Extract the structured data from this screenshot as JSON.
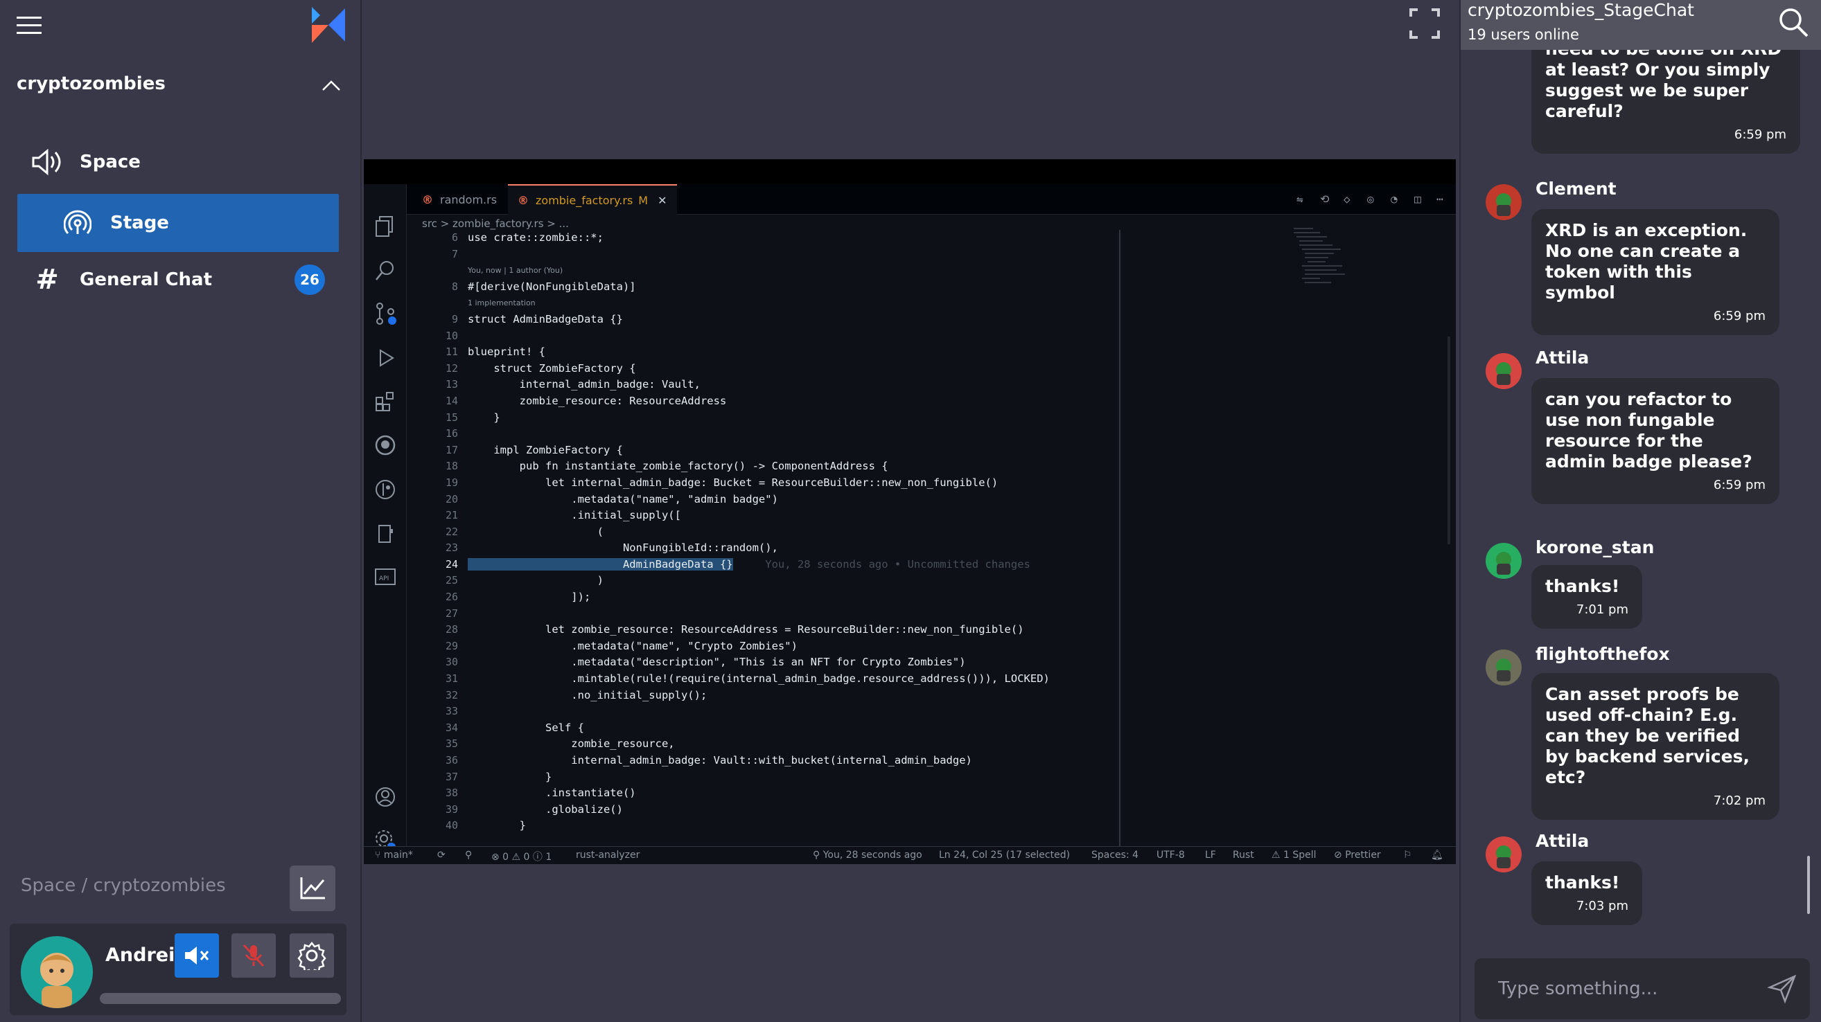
{
  "sidebar": {
    "community": "cryptozombies",
    "items": [
      {
        "label": "Space",
        "icon": "speaker-icon"
      },
      {
        "label": "Stage",
        "icon": "broadcast-icon",
        "active": true
      },
      {
        "label": "General Chat",
        "icon": "hash-icon",
        "badge": "26"
      }
    ],
    "space_path": "Space / cryptozombies",
    "user": {
      "name": "Andrei"
    }
  },
  "editor": {
    "tabs": [
      {
        "label": "random.rs"
      },
      {
        "label": "zombie_factory.rs",
        "modified": "M",
        "active": true
      }
    ],
    "breadcrumb": "src  >  zombie_factory.rs  >  ...",
    "lines": [
      {
        "n": "6",
        "text": "use crate::zombie::*;"
      },
      {
        "n": "7",
        "text": ""
      },
      {
        "n": "",
        "text": "You, now | 1 author (You)",
        "meta": true
      },
      {
        "n": "8",
        "text": "#[derive(NonFungibleData)]"
      },
      {
        "n": "",
        "text": "1 implementation",
        "meta": true
      },
      {
        "n": "9",
        "text": "struct AdminBadgeData {}"
      },
      {
        "n": "10",
        "text": ""
      },
      {
        "n": "11",
        "text": "blueprint! {"
      },
      {
        "n": "12",
        "text": "    struct ZombieFactory {"
      },
      {
        "n": "13",
        "text": "        internal_admin_badge: Vault,"
      },
      {
        "n": "14",
        "text": "        zombie_resource: ResourceAddress"
      },
      {
        "n": "15",
        "text": "    }"
      },
      {
        "n": "16",
        "text": ""
      },
      {
        "n": "17",
        "text": "    impl ZombieFactory {"
      },
      {
        "n": "18",
        "text": "        pub fn instantiate_zombie_factory() -> ComponentAddress {"
      },
      {
        "n": "19",
        "text": "            let internal_admin_badge: Bucket = ResourceBuilder::new_non_fungible()"
      },
      {
        "n": "20",
        "text": "                .metadata(\"name\", \"admin badge\")"
      },
      {
        "n": "21",
        "text": "                .initial_supply(["
      },
      {
        "n": "22",
        "text": "                    ("
      },
      {
        "n": "23",
        "text": "                        NonFungibleId::random(),"
      },
      {
        "n": "24",
        "text": "                        AdminBadgeData {}",
        "hint": "     You, 28 seconds ago • Uncommitted changes",
        "current": true
      },
      {
        "n": "25",
        "text": "                    )"
      },
      {
        "n": "26",
        "text": "                ]);"
      },
      {
        "n": "27",
        "text": ""
      },
      {
        "n": "28",
        "text": "            let zombie_resource: ResourceAddress = ResourceBuilder::new_non_fungible()"
      },
      {
        "n": "29",
        "text": "                .metadata(\"name\", \"Crypto Zombies\")"
      },
      {
        "n": "30",
        "text": "                .metadata(\"description\", \"This is an NFT for Crypto Zombies\")"
      },
      {
        "n": "31",
        "text": "                .mintable(rule!(require(internal_admin_badge.resource_address())), LOCKED)"
      },
      {
        "n": "32",
        "text": "                .no_initial_supply();"
      },
      {
        "n": "33",
        "text": ""
      },
      {
        "n": "34",
        "text": "            Self {"
      },
      {
        "n": "35",
        "text": "                zombie_resource,"
      },
      {
        "n": "36",
        "text": "                internal_admin_badge: Vault::with_bucket(internal_admin_badge)"
      },
      {
        "n": "37",
        "text": "            }"
      },
      {
        "n": "38",
        "text": "            .instantiate()"
      },
      {
        "n": "39",
        "text": "            .globalize()"
      },
      {
        "n": "40",
        "text": "        }"
      }
    ],
    "status": {
      "branch": "main*",
      "problems": "⊗ 0 ⚠ 0 ⓘ 1",
      "analyzer": "rust-analyzer",
      "blame": "You, 28 seconds ago",
      "cursor": "Ln 24, Col 25 (17 selected)",
      "spaces": "Spaces: 4",
      "encoding": "UTF-8",
      "eol": "LF",
      "lang": "Rust",
      "spell": "⚠ 1 Spell",
      "prettier": "Prettier"
    }
  },
  "chat": {
    "title": "cryptozombies_StageChat",
    "online": "19 users online",
    "messages": [
      {
        "author": "",
        "text": "need to be done on XRD at least? Or you simply suggest we be super careful?",
        "time": "6:59 pm"
      },
      {
        "author": "Clement",
        "text": "XRD is an exception. No one can create a token with this symbol",
        "time": "6:59 pm",
        "avatar_color": "#c0392b"
      },
      {
        "author": "Attila",
        "text": "can you refactor to use non fungable resource for the admin badge please?",
        "time": "6:59 pm",
        "avatar_color": "#d64541"
      },
      {
        "author": "korone_stan",
        "text": "thanks!",
        "time": "7:01 pm",
        "avatar_color": "#27ae60"
      },
      {
        "author": "flightofthefox",
        "text": "Can asset proofs be used off-chain? E.g. can they be verified by backend services, etc?",
        "time": "7:02 pm",
        "avatar_color": "#6d6d5a"
      },
      {
        "author": "Attila",
        "text": "thanks!",
        "time": "7:03 pm",
        "avatar_color": "#d64541"
      }
    ],
    "placeholder": "Type something..."
  }
}
